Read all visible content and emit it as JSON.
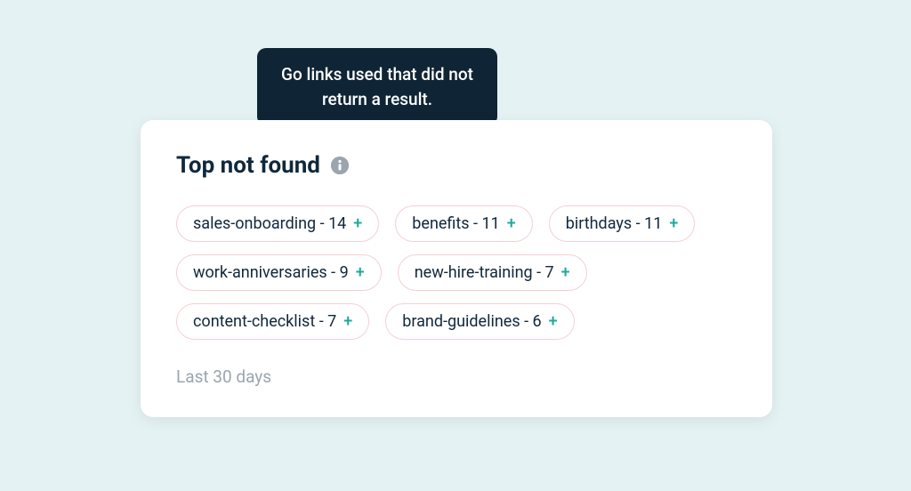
{
  "tooltip": {
    "text": "Go links used that did not return a result."
  },
  "card": {
    "title": "Top not found",
    "footer": "Last 30 days",
    "items": [
      {
        "label": "sales-onboarding",
        "count": 14
      },
      {
        "label": "benefits",
        "count": 11
      },
      {
        "label": "birthdays",
        "count": 11
      },
      {
        "label": "work-anniversaries",
        "count": 9
      },
      {
        "label": "new-hire-training",
        "count": 7
      },
      {
        "label": "content-checklist",
        "count": 7
      },
      {
        "label": "brand-guidelines",
        "count": 6
      }
    ]
  }
}
